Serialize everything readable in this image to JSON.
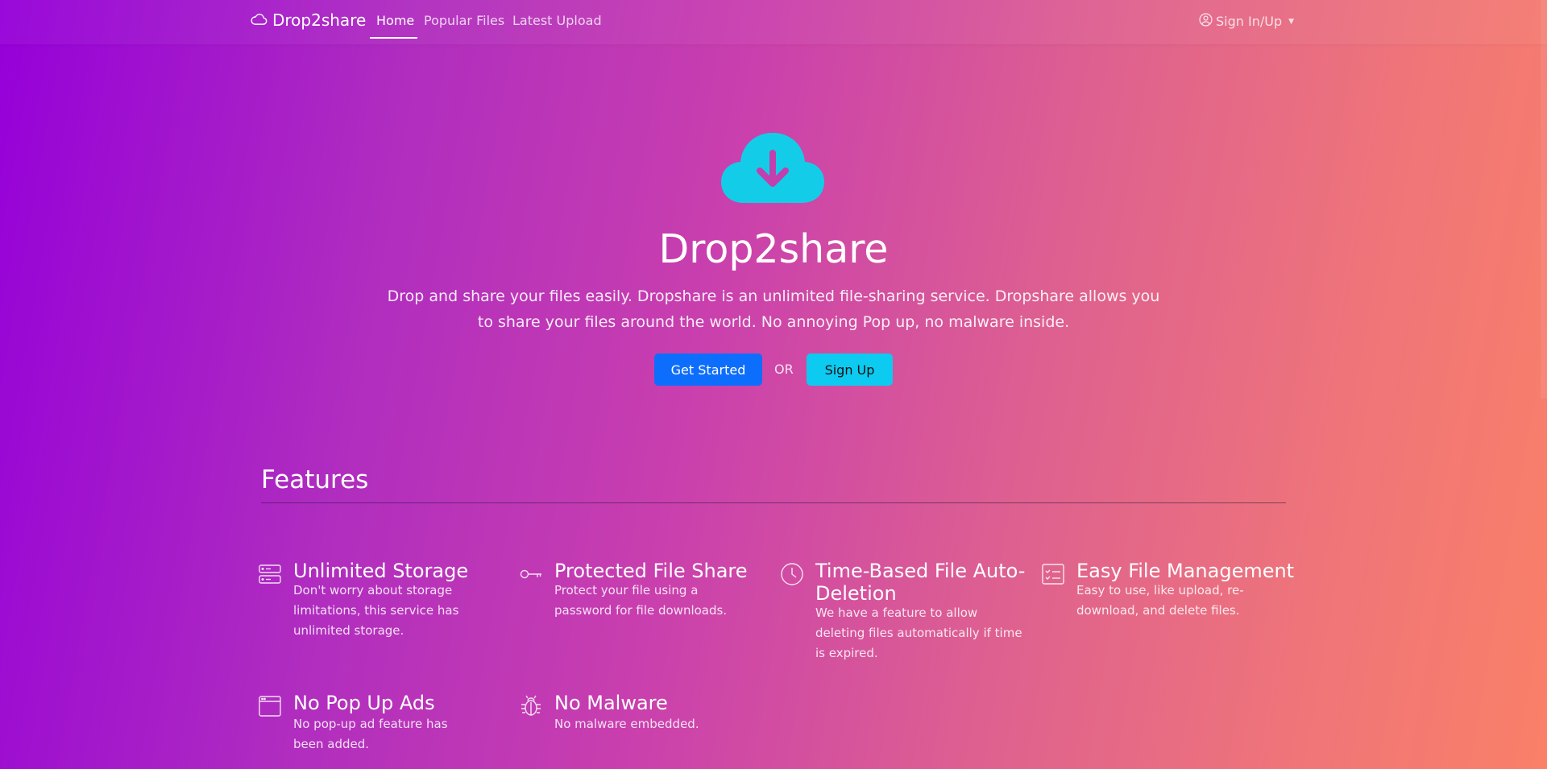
{
  "navbar": {
    "brand": "Drop2share",
    "links": [
      "Home",
      "Popular Files",
      "Latest Upload"
    ],
    "active": "Home",
    "signin": "Sign In/Up",
    "brand_icon": "cloud-icon",
    "signin_icon": "user-circle-icon"
  },
  "hero": {
    "icon": "cloud-download-icon",
    "title": "Drop2share",
    "description": "Drop and share your files easily. Dropshare is an unlimited file-sharing service. Dropshare allows you to share your files around the world. No annoying Pop up, no malware inside.",
    "primary_button": "Get Started",
    "or_label": "OR",
    "secondary_button": "Sign Up"
  },
  "features": {
    "title": "Features",
    "items": [
      {
        "icon": "storage-icon",
        "title": "Unlimited Storage",
        "description": "Don't worry about storage limitations, this service has unlimited storage."
      },
      {
        "icon": "key-icon",
        "title": "Protected File Share",
        "description": "Protect your file using a password for file downloads."
      },
      {
        "icon": "clock-icon",
        "title": "Time-Based File Auto-Deletion",
        "description": "We have a feature to allow deleting files automatically if time is expired."
      },
      {
        "icon": "checklist-icon",
        "title": "Easy File Management",
        "description": "Easy to use, like upload, re-download, and delete files."
      },
      {
        "icon": "window-icon",
        "title": "No Pop Up Ads",
        "description": "No pop-up ad feature has been added."
      },
      {
        "icon": "bug-icon",
        "title": "No Malware",
        "description": "No malware embedded."
      }
    ]
  },
  "colors": {
    "primary": "#0d6efd",
    "info": "#0dcaf0",
    "gradient_start": "#9500d9",
    "gradient_end": "#fa8068"
  }
}
